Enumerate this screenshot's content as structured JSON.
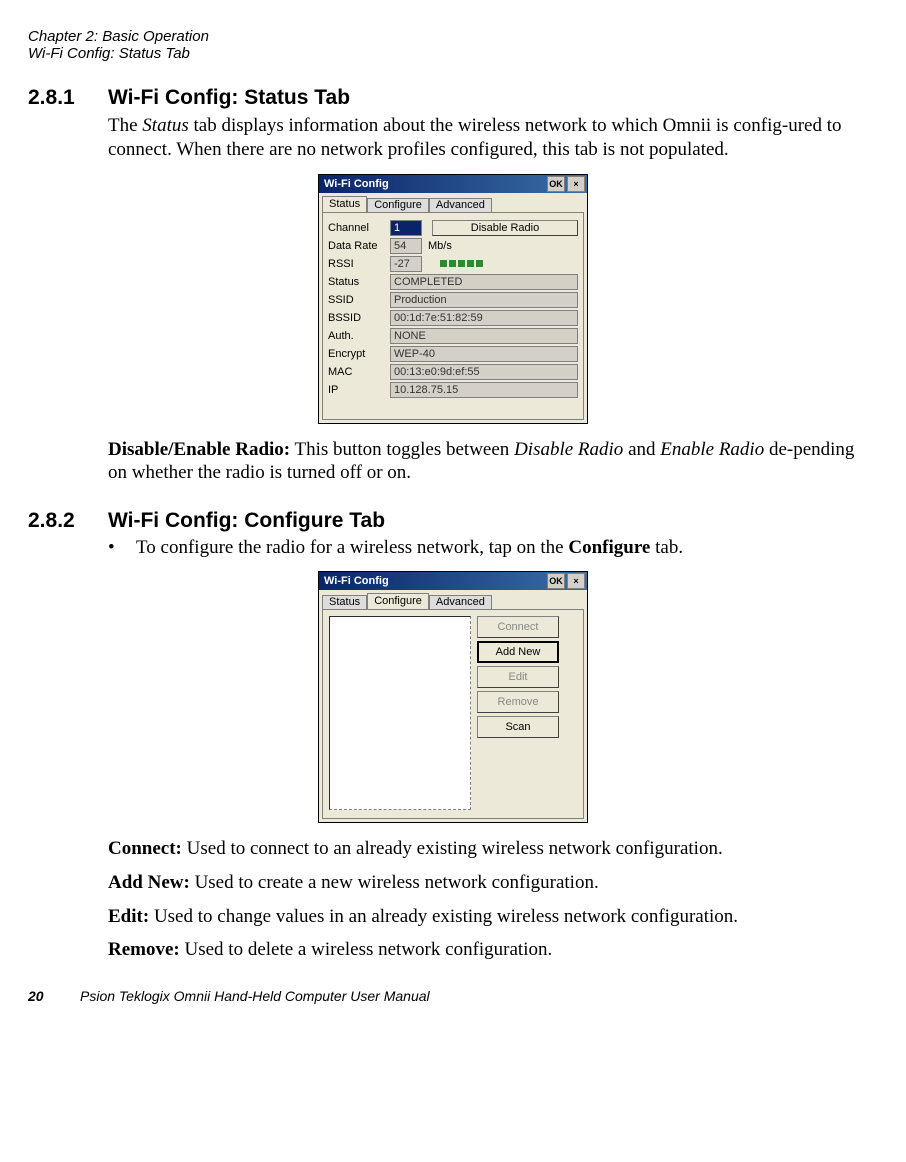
{
  "header": {
    "chapter": "Chapter 2:  Basic Operation",
    "section": "Wi-Fi Config: Status Tab"
  },
  "sec1": {
    "num": "2.8.1",
    "title": "Wi-Fi Config: Status Tab",
    "para1_a": "The ",
    "para1_b": "Status",
    "para1_c": " tab displays information about the wireless network to which Omnii is config-ured to connect. When there are no network profiles configured, this tab is not populated.",
    "para2_a": "Disable/Enable Radio:",
    "para2_b": " This button toggles between ",
    "para2_c": "Disable Radio",
    "para2_d": " and ",
    "para2_e": "Enable Radio",
    "para2_f": " de-pending on whether the radio is turned off or on."
  },
  "sec2": {
    "num": "2.8.2",
    "title": "Wi-Fi Config: Configure Tab",
    "bullet_a": "To configure the radio for a wireless network, tap on the ",
    "bullet_b": "Configure",
    "bullet_c": " tab.",
    "connect_a": "Connect:",
    "connect_b": " Used to connect to an already existing wireless network configuration.",
    "addnew_a": "Add New:",
    "addnew_b": " Used to create a new wireless network configuration.",
    "edit_a": "Edit:",
    "edit_b": " Used to change values in an already existing wireless network configuration.",
    "remove_a": "Remove:",
    "remove_b": " Used to delete a wireless network configuration."
  },
  "shot1": {
    "title": "Wi-Fi Config",
    "ok": "OK",
    "close": "×",
    "tabs": {
      "status": "Status",
      "configure": "Configure",
      "advanced": "Advanced"
    },
    "labels": {
      "channel": "Channel",
      "datarate": "Data Rate",
      "rssi": "RSSI",
      "status": "Status",
      "ssid": "SSID",
      "bssid": "BSSID",
      "auth": "Auth.",
      "encrypt": "Encrypt",
      "mac": "MAC",
      "ip": "IP"
    },
    "values": {
      "channel": "1",
      "datarate": "54",
      "datarate_unit": "Mb/s",
      "rssi": "-27",
      "status": "COMPLETED",
      "ssid": "Production",
      "bssid": "00:1d:7e:51:82:59",
      "auth": "NONE",
      "encrypt": "WEP-40",
      "mac": "00:13:e0:9d:ef:55",
      "ip": "10.128.75.15"
    },
    "disable_btn": "Disable Radio"
  },
  "shot2": {
    "title": "Wi-Fi Config",
    "ok": "OK",
    "close": "×",
    "tabs": {
      "status": "Status",
      "configure": "Configure",
      "advanced": "Advanced"
    },
    "buttons": {
      "connect": "Connect",
      "addnew": "Add New",
      "edit": "Edit",
      "remove": "Remove",
      "scan": "Scan"
    }
  },
  "footer": {
    "page": "20",
    "text": "Psion Teklogix Omnii Hand-Held Computer User Manual"
  }
}
